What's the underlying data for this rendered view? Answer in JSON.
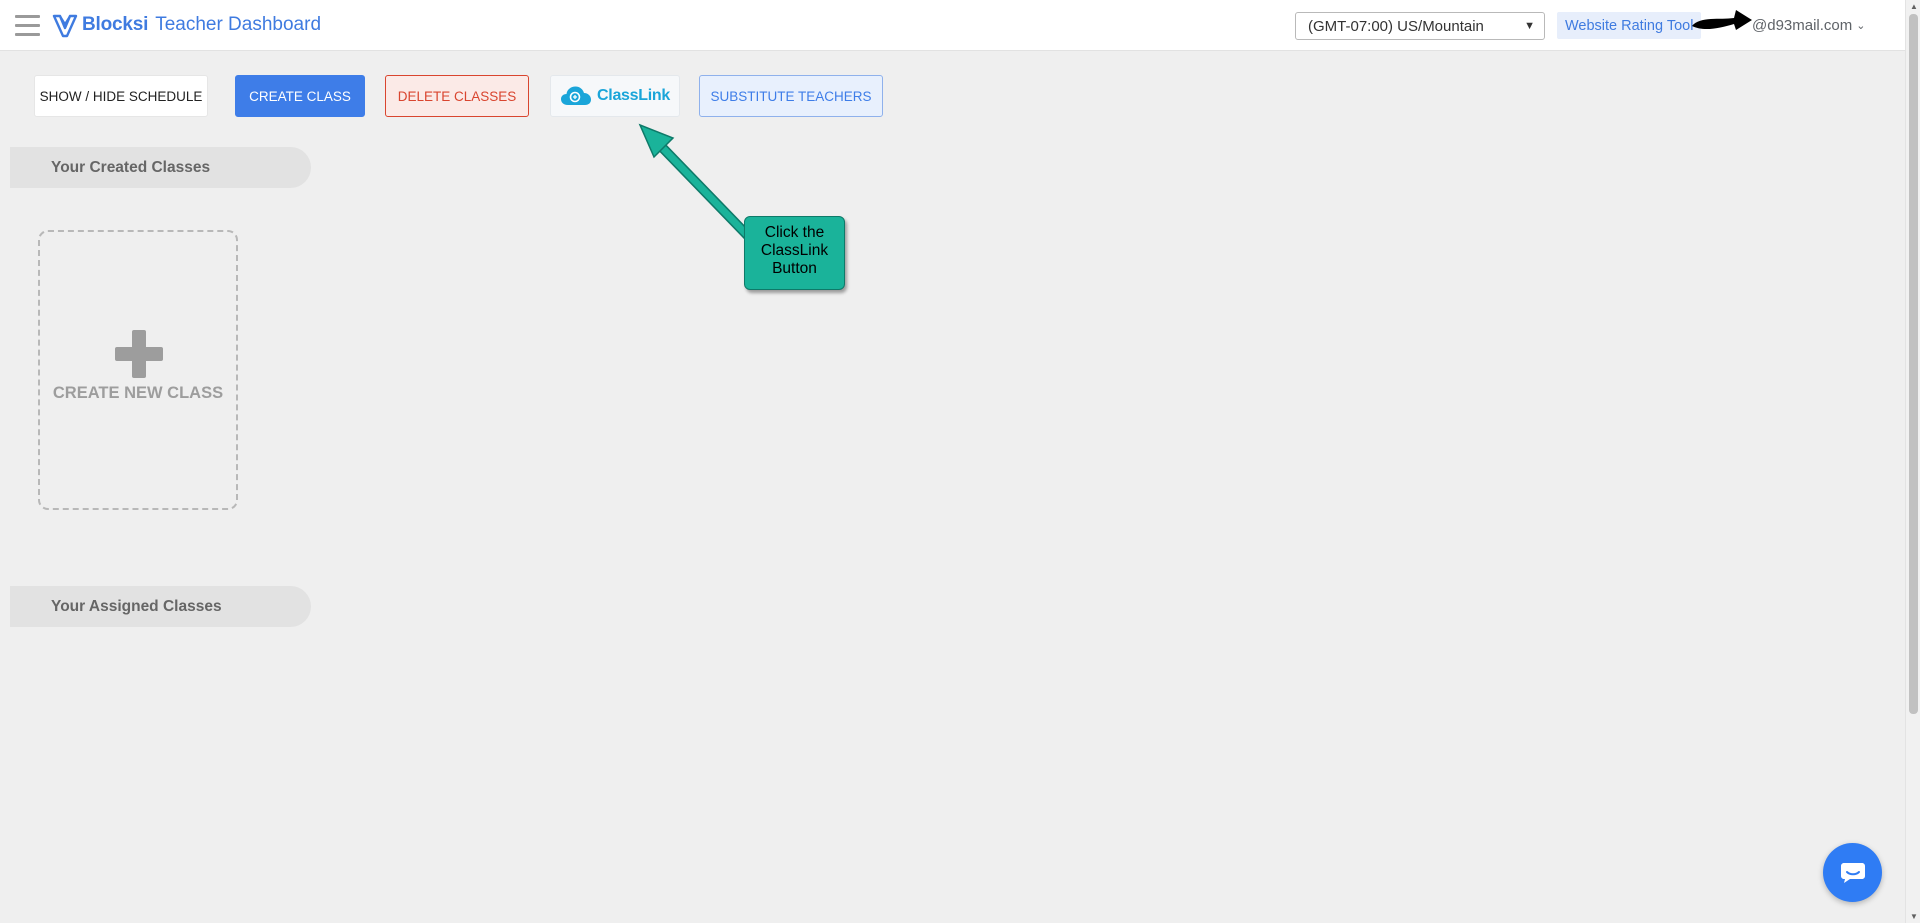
{
  "header": {
    "brand_name": "Blocksi",
    "app_title": "Teacher Dashboard",
    "timezone_value": "(GMT-07:00) US/Mountain",
    "website_rating_tool": "Website Rating Tool",
    "user_email": "@d93mail.com",
    "colors": {
      "brand": "#3f7be0"
    }
  },
  "toolbar": {
    "show_hide_schedule": "SHOW / HIDE SCHEDULE",
    "create_class": "CREATE CLASS",
    "delete_classes": "DELETE CLASSES",
    "classlink": "ClassLink",
    "substitute_teachers": "SUBSTITUTE TEACHERS"
  },
  "sections": {
    "created_classes": "Your Created Classes",
    "assigned_classes": "Your Assigned Classes"
  },
  "create_new_class_card": {
    "label": "CREATE NEW CLASS",
    "icon": "plus-icon"
  },
  "tutorial_callout": {
    "text_lines": [
      "Click the",
      "ClassLink",
      "Button"
    ],
    "color": "#1ab39a"
  },
  "icons": {
    "menu": "hamburger-icon",
    "chat": "chat-icon",
    "dropdown": "chevron-down-icon"
  }
}
